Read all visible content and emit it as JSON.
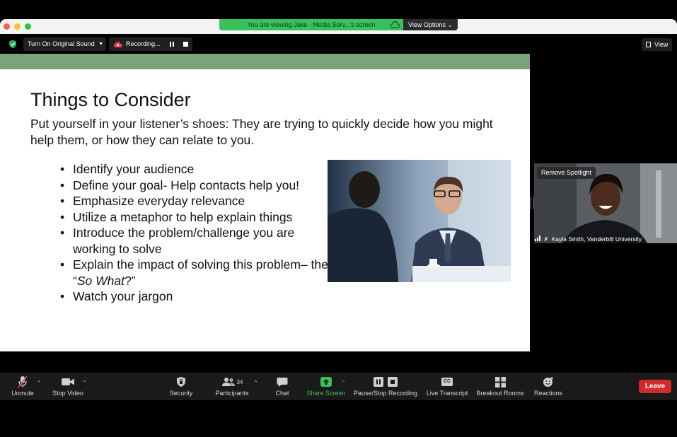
{
  "banner": {
    "viewing_text": "You are viewing Jake - Media Serv...'s screen",
    "view_options_label": "View Options ⌄"
  },
  "top_toolbar": {
    "original_sound_label": "Turn On Original Sound",
    "recording_label": "Recording...",
    "view_label": "View"
  },
  "slide": {
    "title": "Things to Consider",
    "intro": "Put yourself in your listener’s shoes: They are trying to quickly decide how you might help them, or how they can relate to you.",
    "bullets": [
      "Identify your audience",
      "Define your goal- Help contacts help you!",
      "Emphasize everyday relevance",
      "Utilize a metaphor to help explain things",
      "Introduce the problem/challenge you are working to solve",
      "Explain the impact of solving this problem– the “So What?”",
      "Watch your jargon"
    ],
    "bullet6_prefix": "Explain the impact of solving this problem– the “",
    "bullet6_emph": "So What",
    "bullet6_suffix": "?”"
  },
  "video": {
    "remove_spotlight_label": "Remove Spotlight",
    "participant_name": "Kayla Smith, Vanderbilt University"
  },
  "bottom_toolbar": {
    "unmute": "Unmute",
    "stop_video": "Stop Video",
    "security": "Security",
    "participants": "Participants",
    "participants_count": "34",
    "chat": "Chat",
    "share_screen": "Share Screen",
    "pause_stop_recording": "Pause/Stop Recording",
    "live_transcript": "Live Transcript",
    "live_transcript_badge": "CC",
    "breakout_rooms": "Breakout Rooms",
    "reactions": "Reactions",
    "leave": "Leave"
  },
  "colors": {
    "share_green": "#39c15a",
    "leave_red": "#d22a2a",
    "slide_band": "#7aa37a"
  }
}
